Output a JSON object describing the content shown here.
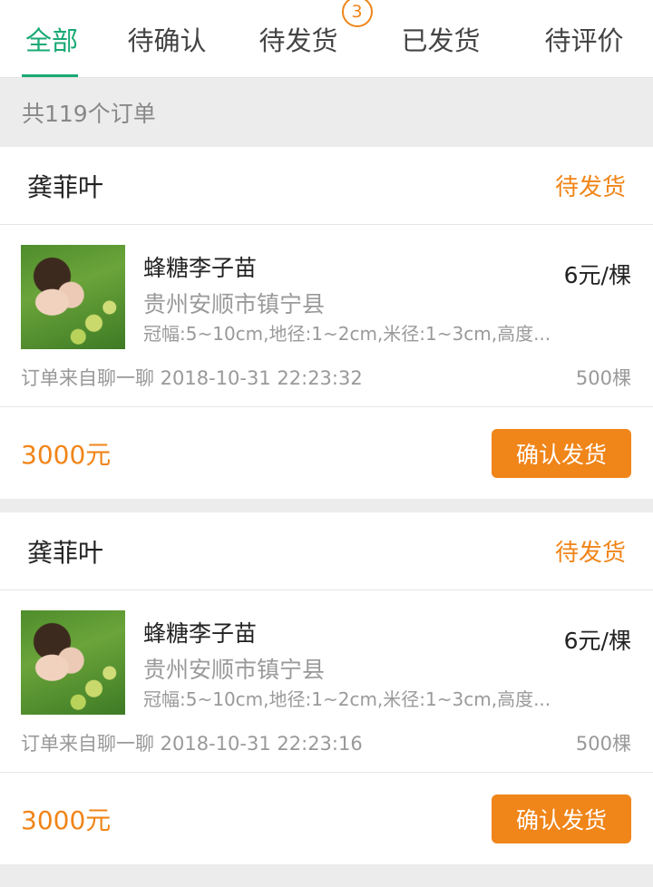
{
  "tabs": [
    {
      "label": "全部",
      "active": true
    },
    {
      "label": "待确认"
    },
    {
      "label": "待发货",
      "badge": "3"
    },
    {
      "label": "已发货"
    },
    {
      "label": "待评价"
    }
  ],
  "summary": "共119个订单",
  "orders": [
    {
      "buyer": "龚菲叶",
      "status": "待发货",
      "product": "蜂糖李子苗",
      "location": "贵州安顺市镇宁县",
      "spec": "冠幅:5~10cm,地径:1~2cm,米径:1~3cm,高度...",
      "price": "6元/棵",
      "source": "订单来自聊一聊 2018-10-31 22:23:32",
      "quantity": "500棵",
      "total": "3000元",
      "action": "确认发货"
    },
    {
      "buyer": "龚菲叶",
      "status": "待发货",
      "product": "蜂糖李子苗",
      "location": "贵州安顺市镇宁县",
      "spec": "冠幅:5~10cm,地径:1~2cm,米径:1~3cm,高度...",
      "price": "6元/棵",
      "source": "订单来自聊一聊 2018-10-31 22:23:16",
      "quantity": "500棵",
      "total": "3000元",
      "action": "确认发货"
    }
  ],
  "colors": {
    "accent_green": "#19a974",
    "accent_orange": "#f08519"
  }
}
